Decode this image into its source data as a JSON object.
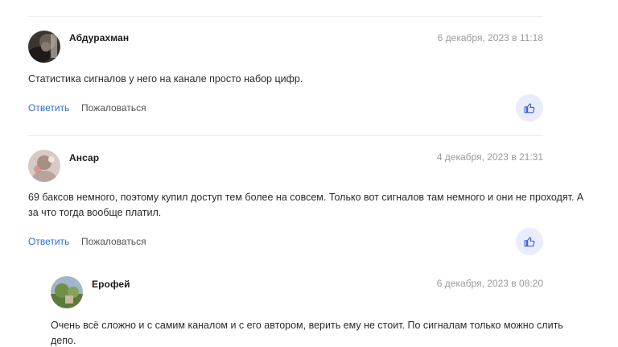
{
  "comments": [
    {
      "author": "Абдурахман",
      "date": "6 декабря, 2023 в 11:18",
      "text": "Статистика сигналов у него на канале просто набор цифр.",
      "reply_label": "Ответить",
      "report_label": "Пожаловаться"
    },
    {
      "author": "Ансар",
      "date": "4 декабря, 2023 в 21:31",
      "text_line1": "69 баксов немного, поэтому купил доступ тем более на совсем. Только вот сигналов там немного и они не проходят. А",
      "text_line2": "за что тогда вообще платил.",
      "reply_label": "Ответить",
      "report_label": "Пожаловаться"
    }
  ],
  "reply": {
    "author": "Ерофей",
    "date": "6 декабря, 2023 в 08:20",
    "text_line1": "Очень всё сложно и с самим каналом и с его автором, верить ему не стоит. По сигналам только можно слить",
    "text_line2": "депо."
  },
  "icons": {
    "like": "thumbs-up-icon"
  },
  "colors": {
    "link": "#2d6fd6",
    "like_bg": "#e9edfb",
    "like_icon": "#3b5fd9"
  }
}
